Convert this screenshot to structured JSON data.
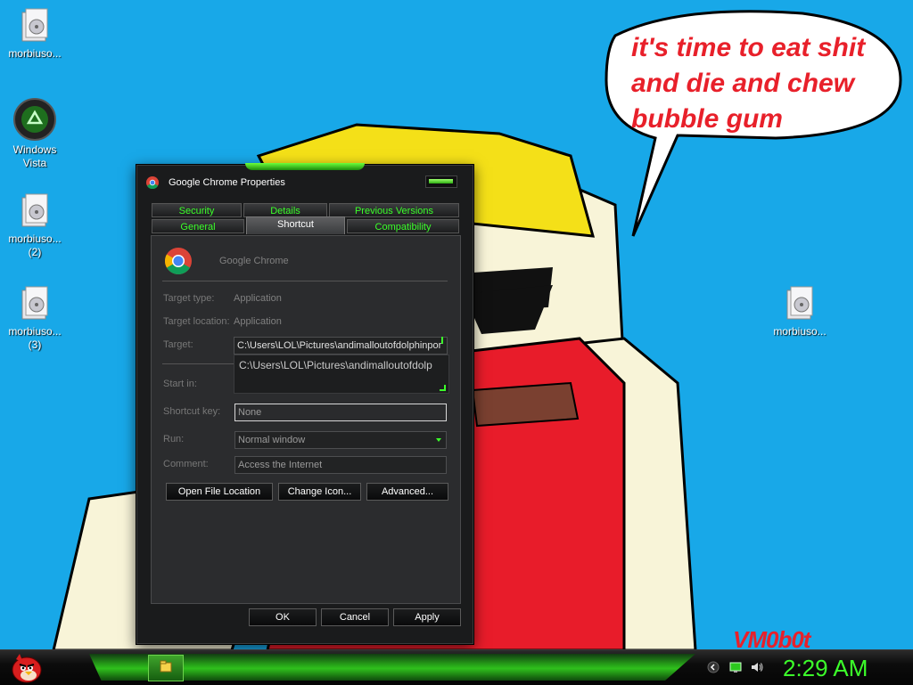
{
  "desktop": {
    "icons": [
      {
        "label": "morbiuso...",
        "type": "folder"
      },
      {
        "label": "Windows\nVista",
        "type": "recycle-bin"
      },
      {
        "label": "morbiuso...\n(2)",
        "type": "folder"
      },
      {
        "label": "morbiuso...\n(3)",
        "type": "folder"
      },
      {
        "label": "morbiuso...",
        "type": "folder"
      }
    ],
    "speech_lines": [
      "it's time to eat shit",
      "and die and chew",
      "bubble gum"
    ],
    "signature": "VM0b0t"
  },
  "dialog": {
    "title": "Google Chrome Properties",
    "tabs_row1": [
      "Security",
      "Details",
      "Previous Versions"
    ],
    "tabs_row2": [
      "General",
      "Shortcut",
      "Compatibility"
    ],
    "active_tab": "Shortcut",
    "app_name": "Google Chrome",
    "target_type_label": "Target type:",
    "target_type_value": "Application",
    "target_location_label": "Target location:",
    "target_location_value": "Application",
    "target_label": "Target:",
    "target_value": "C:\\Users\\LOL\\Pictures\\andimalloutofdolphinpor",
    "autocomplete_value": "C:\\Users\\LOL\\Pictures\\andimalloutofdolp",
    "start_in_label": "Start in:",
    "shortcut_key_label": "Shortcut key:",
    "shortcut_key_value": "None",
    "run_label": "Run:",
    "run_value": "Normal window",
    "comment_label": "Comment:",
    "comment_value": "Access the Internet",
    "open_file_location": "Open File Location",
    "change_icon": "Change Icon...",
    "advanced": "Advanced...",
    "ok": "OK",
    "cancel": "Cancel",
    "apply": "Apply"
  },
  "taskbar": {
    "clock": "2:29 AM"
  },
  "colors": {
    "desktop_bg": "#18a8e8",
    "accent_green": "#3bff2a",
    "speech_red": "#e8202a"
  }
}
